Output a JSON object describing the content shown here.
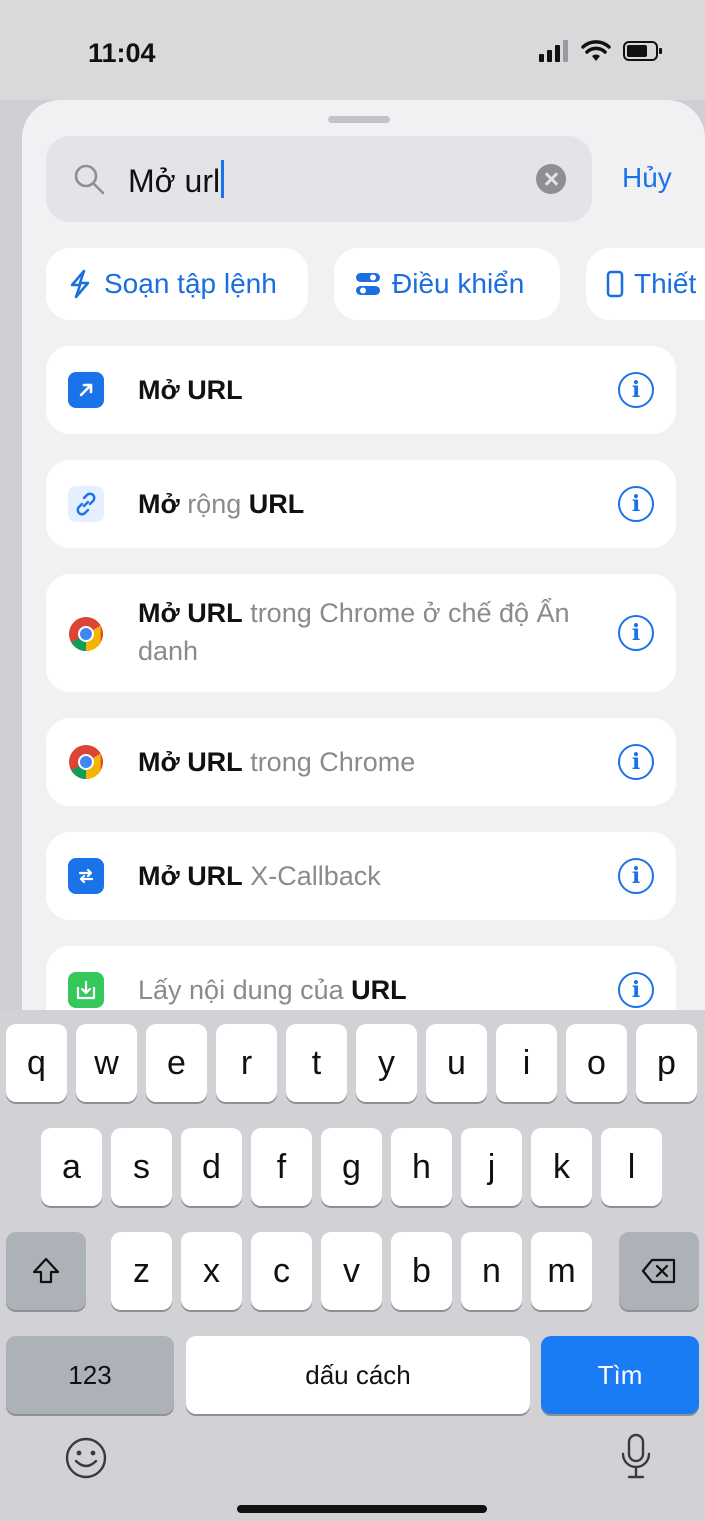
{
  "status_bar": {
    "time": "11:04"
  },
  "search": {
    "value": "Mở url",
    "cancel_label": "Hủy"
  },
  "chips": [
    {
      "label": "Soạn tập lệnh",
      "icon": "script-icon"
    },
    {
      "label": "Điều khiển",
      "icon": "toggle-icon"
    },
    {
      "label": "Thiết",
      "icon": "device-icon"
    }
  ],
  "results": [
    {
      "icon": "open-url-icon",
      "parts": [
        {
          "t": "Mở URL",
          "b": true
        }
      ]
    },
    {
      "icon": "link-icon",
      "parts": [
        {
          "t": "Mở",
          "b": true
        },
        {
          "t": " rộng ",
          "b": false
        },
        {
          "t": "URL",
          "b": true
        }
      ]
    },
    {
      "icon": "chrome-icon",
      "parts": [
        {
          "t": "Mở URL",
          "b": true
        },
        {
          "t": " trong Chrome ở chế độ Ẩn danh",
          "b": false
        }
      ]
    },
    {
      "icon": "chrome-icon",
      "parts": [
        {
          "t": "Mở URL",
          "b": true
        },
        {
          "t": " trong Chrome",
          "b": false
        }
      ]
    },
    {
      "icon": "x-callback-icon",
      "parts": [
        {
          "t": "Mở URL",
          "b": true
        },
        {
          "t": " X-Callback",
          "b": false
        }
      ]
    },
    {
      "icon": "download-icon",
      "parts": [
        {
          "t": "Lấy nội dung của ",
          "b": false
        },
        {
          "t": "URL",
          "b": true
        }
      ]
    }
  ],
  "keyboard": {
    "row1": [
      "q",
      "w",
      "e",
      "r",
      "t",
      "y",
      "u",
      "i",
      "o",
      "p"
    ],
    "row2": [
      "a",
      "s",
      "d",
      "f",
      "g",
      "h",
      "j",
      "k",
      "l"
    ],
    "row3": [
      "z",
      "x",
      "c",
      "v",
      "b",
      "n",
      "m"
    ],
    "numbers_label": "123",
    "space_label": "dấu cách",
    "search_label": "Tìm"
  },
  "colors": {
    "accent": "#1a73e8",
    "key_blue": "#1a7cf5"
  }
}
